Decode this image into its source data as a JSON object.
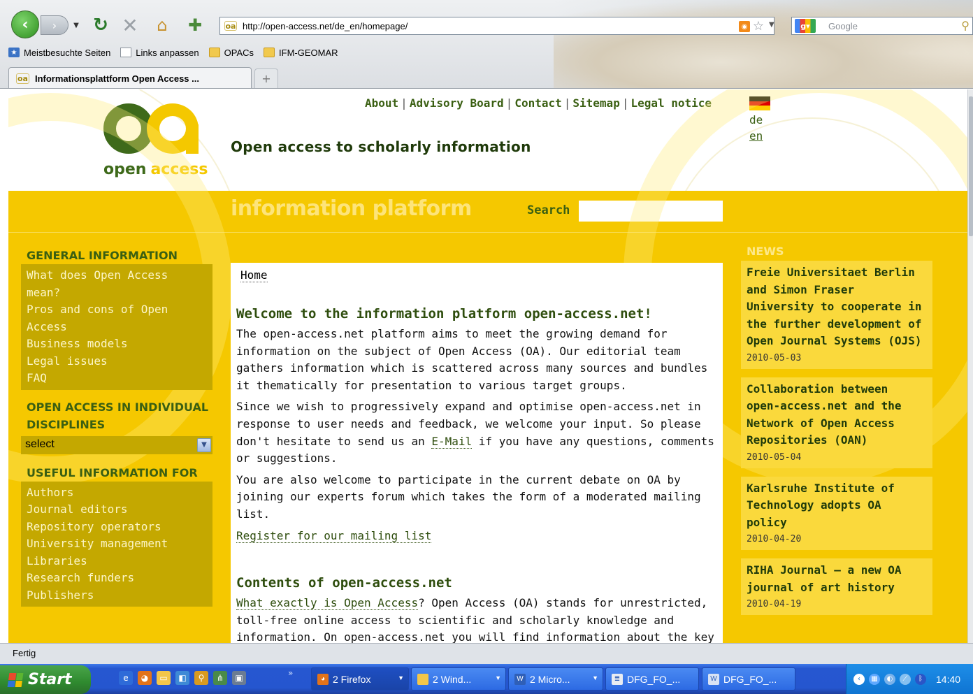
{
  "browser": {
    "url": "http://open-access.net/de_en/homepage/",
    "search_placeholder": "Google",
    "bookmarks": [
      {
        "label": "Meistbesuchte Seiten",
        "icon": "most-visited-icon"
      },
      {
        "label": "Links anpassen",
        "icon": "page-icon"
      },
      {
        "label": "OPACs",
        "icon": "folder-icon"
      },
      {
        "label": "IFM-GEOMAR",
        "icon": "folder-icon"
      }
    ],
    "active_tab_title": "Informationsplattform Open Access ...",
    "new_tab_label": "+",
    "status": "Fertig"
  },
  "site": {
    "logo_open": "open",
    "logo_access": "access",
    "topnav": [
      "About",
      "Advisory Board",
      "Contact",
      "Sitemap",
      "Legal notice"
    ],
    "tagline": "Open access to scholarly information",
    "lang_de": "de",
    "lang_en": "en",
    "platform_title": "information platform",
    "search_label": "Search"
  },
  "sidebar": {
    "general_heading": "GENERAL INFORMATION",
    "general_links": [
      "What does Open Access mean?",
      "Pros and cons of Open Access",
      "Business models",
      "Legal issues",
      "FAQ"
    ],
    "disciplines_heading": "OPEN ACCESS IN INDIVIDUAL DISCIPLINES",
    "disciplines_select": "select",
    "useful_heading": "USEFUL INFORMATION FOR",
    "useful_links": [
      "Authors",
      "Journal editors",
      "Repository operators",
      "University management",
      "Libraries",
      "Research funders",
      "Publishers"
    ]
  },
  "content": {
    "breadcrumb": "Home",
    "welcome_heading": "Welcome to the information platform open-access.net!",
    "p1": "The open-access.net platform aims to meet the growing demand for information on the subject of Open Access (OA). Our editorial team gathers information which is scattered across many sources and bundles it thematically for presentation to various target groups.",
    "p2_before": "Since we wish to progressively expand and optimise open-access.net in response to user needs and feedback, we welcome your input. So please don't hesitate to send us an ",
    "p2_link": "E-Mail",
    "p2_after": " if you have any questions, comments or suggestions.",
    "p3": "You are also welcome to participate in the current debate on OA by joining our experts forum which takes the form of a moderated mailing list.",
    "register_link": "Register for our mailing list",
    "contents_heading": "Contents of open-access.net",
    "p4_link": "What exactly is Open Access",
    "p4_after": "? Open Access (OA) stands for unrestricted, toll-free online access to scientific and scholarly knowledge and information. On open-access.net you will find information about the key"
  },
  "news": {
    "heading": "NEWS",
    "items": [
      {
        "title": "Freie Universitaet Berlin and Simon Fraser University to cooperate in the further development of Open Journal Systems (OJS)",
        "date": "2010-05-03"
      },
      {
        "title": "Collaboration between open-access.net and the Network of Open Access Repositories (OAN)",
        "date": "2010-05-04"
      },
      {
        "title": "Karlsruhe Institute of Technology adopts OA policy",
        "date": "2010-04-20"
      },
      {
        "title": "RIHA Journal – a new OA journal of art history",
        "date": "2010-04-19"
      }
    ]
  },
  "taskbar": {
    "start_label": "Start",
    "tasks": [
      {
        "label": "2 Firefox",
        "icon": "firefox-icon"
      },
      {
        "label": "2 Wind...",
        "icon": "folder-icon"
      },
      {
        "label": "2 Micro...",
        "icon": "word-icon"
      },
      {
        "label": "DFG_FO_...",
        "icon": "document-icon"
      },
      {
        "label": "DFG_FO_...",
        "icon": "word-doc-icon"
      }
    ],
    "clock": "14:40"
  },
  "colors": {
    "oa_yellow": "#f5c800",
    "oa_green": "#3e6a1a",
    "sidebar_box": "#c4a800",
    "news_box": "#fad93c"
  }
}
